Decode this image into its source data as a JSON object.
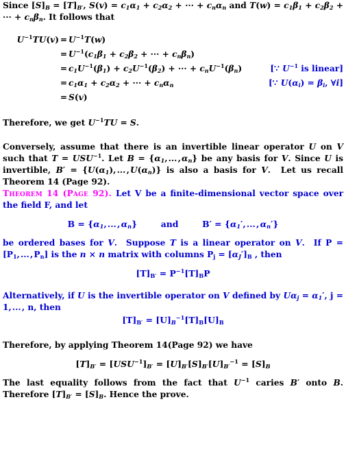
{
  "document": {
    "type": "mathematical-proof",
    "colors": {
      "body_text": "#000000",
      "highlight_blue": "#0000d0",
      "theorem_heading_magenta": "#ff00ff",
      "background": "#ffffff"
    },
    "intro": {
      "line1_pre": "Since ",
      "line1_math": "[S]",
      "text": "Since [S]B = [T]B′, S(v) = c1α1 + c2α2 + ··· + cnαn and T(w) = c1β1 + c2β2 + ··· + cnβn. It follows that"
    },
    "derivation": {
      "rows": [
        {
          "lhs": "U⁻¹TU(v)",
          "rel": "=",
          "rhs": "U⁻¹T(w)",
          "note": ""
        },
        {
          "lhs": "",
          "rel": "=",
          "rhs": "U⁻¹(c1β1 + c2β2 + ··· + cnβn)",
          "note": ""
        },
        {
          "lhs": "",
          "rel": "=",
          "rhs": "c1U⁻¹(β1) + c2U⁻¹(β2) + ··· + cnU⁻¹(βn)",
          "note": "[∵ U⁻¹ is linear]"
        },
        {
          "lhs": "",
          "rel": "=",
          "rhs": "c1α1 + c2α2 + ··· + cnαn",
          "note": "[∵ U(αi) = βi, ∀i]"
        },
        {
          "lhs": "",
          "rel": "=",
          "rhs": "S(v)",
          "note": ""
        }
      ]
    },
    "conclusion_first": "Therefore, we get U⁻¹TU = S.",
    "converse_paragraph": "Conversely, assume that there is an invertible linear operator U on V such that T = USU⁻¹. Let B = {α1, ..., αn} be any basis for V. Since U is invertible, B′ = {U(α1), ..., U(αn)} is also a basis for V. Let us recall Theorem 14 (Page 92).",
    "theorem_recall_label": "Theorem 14 (Page 92).",
    "theorem": {
      "heading": "Theorem 14 (Page 92).",
      "statement_line1": "Let V be a finite-dimensional vector space over",
      "statement_line2": "the field F, and let",
      "basis_display": {
        "left": "B = {α1, ..., αn}",
        "conjunction": "and",
        "right": "B′ = {α′1, ..., α′n}"
      },
      "body_line1": "be ordered bases for V. Suppose T is a linear operator on V. If P =",
      "body_line2": "[P1, ..., Pn] is the n × n matrix with columns Pj = [α′j]B , then",
      "equation1": "[T]B′ = P⁻¹[T]BP",
      "alt_line1": "Alternatively, if U is the invertible operator on V defined by Uαj = α′1,",
      "alt_line2": "j = 1, ..., n, then",
      "equation2": "[T]B′ = [U]B⁻¹[T]B[U]B"
    },
    "apply_line": "Therefore, by applying Theorem 14(Page 92) we have",
    "final_equation": "[T]B′ = [USU⁻¹]B′ = [U]B′[S]B′[U]B′⁻¹ = [S]B",
    "closing_paragraph": "The last equality follows from the fact that U⁻¹ caries B′ onto B. Therefore [T]B′ = [S]B. Hence the prove."
  }
}
